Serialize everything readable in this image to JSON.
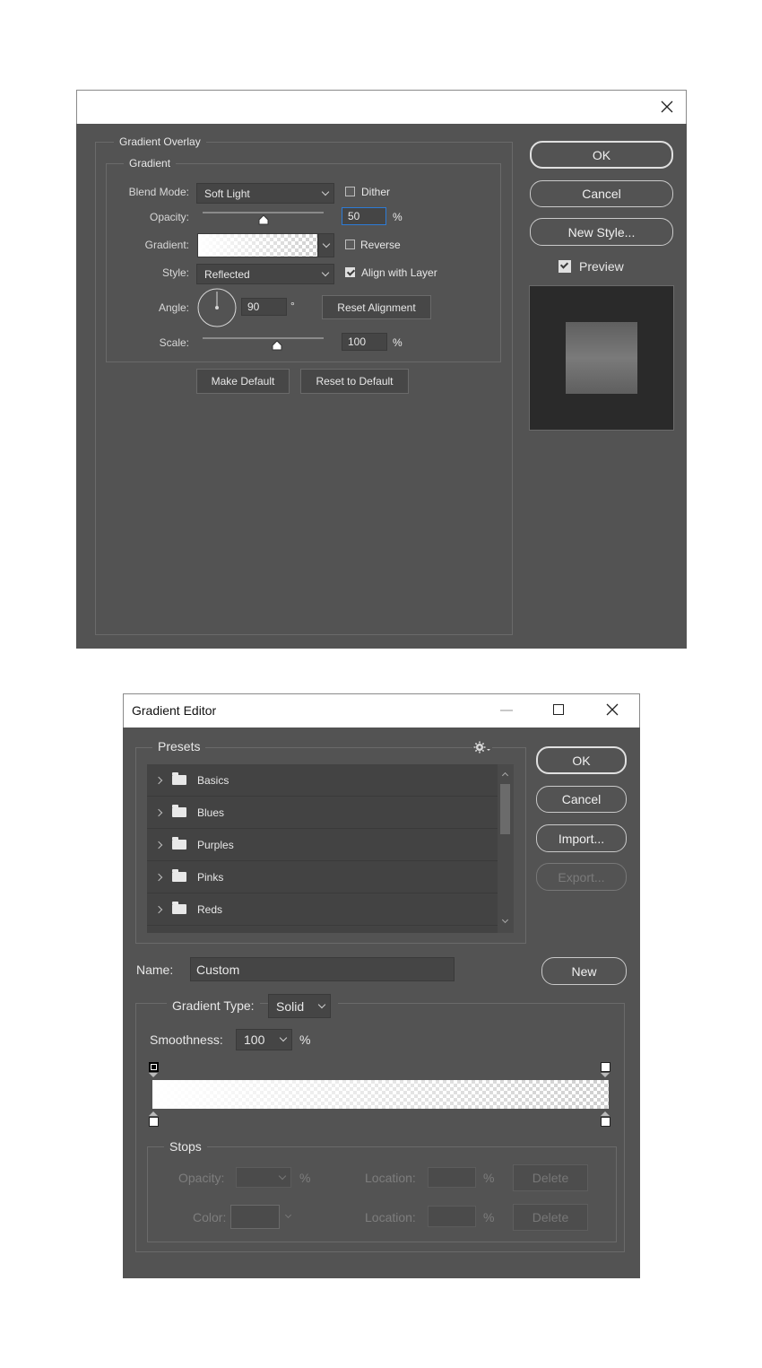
{
  "gradient_overlay": {
    "outer_legend": "Gradient Overlay",
    "inner_legend": "Gradient",
    "blend_mode_label": "Blend Mode:",
    "blend_mode_value": "Soft Light",
    "dither_label": "Dither",
    "dither_checked": false,
    "opacity_label": "Opacity:",
    "opacity_value": "50",
    "opacity_unit": "%",
    "gradient_label": "Gradient:",
    "reverse_label": "Reverse",
    "reverse_checked": false,
    "style_label": "Style:",
    "style_value": "Reflected",
    "align_label": "Align with Layer",
    "align_checked": true,
    "angle_label": "Angle:",
    "angle_value": "90",
    "angle_unit": "°",
    "reset_alignment_label": "Reset Alignment",
    "scale_label": "Scale:",
    "scale_value": "100",
    "scale_unit": "%",
    "make_default_label": "Make Default",
    "reset_default_label": "Reset to Default",
    "ok_label": "OK",
    "cancel_label": "Cancel",
    "new_style_label": "New Style...",
    "preview_label": "Preview",
    "preview_checked": true
  },
  "gradient_editor": {
    "title": "Gradient Editor",
    "presets_label": "Presets",
    "presets": [
      "Basics",
      "Blues",
      "Purples",
      "Pinks",
      "Reds"
    ],
    "ok_label": "OK",
    "cancel_label": "Cancel",
    "import_label": "Import...",
    "export_label": "Export...",
    "name_label": "Name:",
    "name_value": "Custom",
    "new_label": "New",
    "gradient_type_label": "Gradient Type:",
    "gradient_type_value": "Solid",
    "smoothness_label": "Smoothness:",
    "smoothness_value": "100",
    "smoothness_unit": "%",
    "stops_label": "Stops",
    "stops_opacity_label": "Opacity:",
    "stops_opacity_unit": "%",
    "stops_location_label": "Location:",
    "stops_location_unit": "%",
    "stops_color_label": "Color:",
    "delete_label": "Delete"
  }
}
